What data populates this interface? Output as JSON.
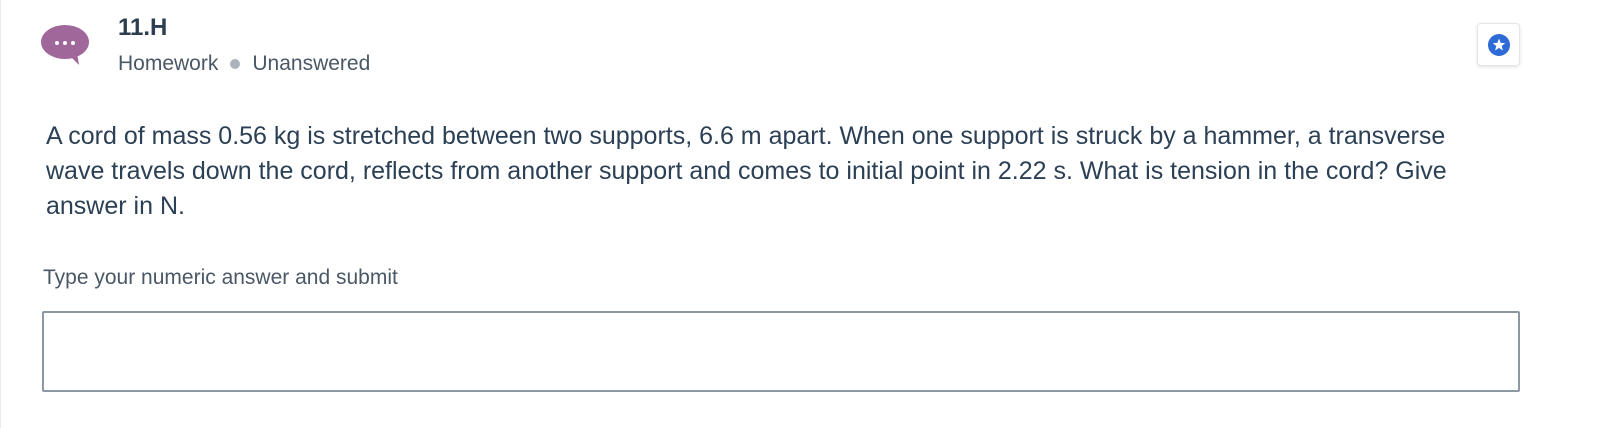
{
  "header": {
    "title": "11.H",
    "category": "Homework",
    "status": "Unanswered",
    "avatar_icon": "speech-bubble-ellipsis",
    "avatar_color": "#a0679a",
    "star_icon": "star-badge",
    "star_color": "#2f6bd6"
  },
  "question": {
    "text": "A cord of mass 0.56 kg is stretched between two supports, 6.6 m apart. When one support is struck by a hammer, a transverse wave travels down the cord, reflects from another support and comes to initial point in 2.22 s. What is tension in the cord? Give answer in N."
  },
  "answer": {
    "label": "Type your numeric answer and submit",
    "value": "",
    "placeholder": ""
  }
}
